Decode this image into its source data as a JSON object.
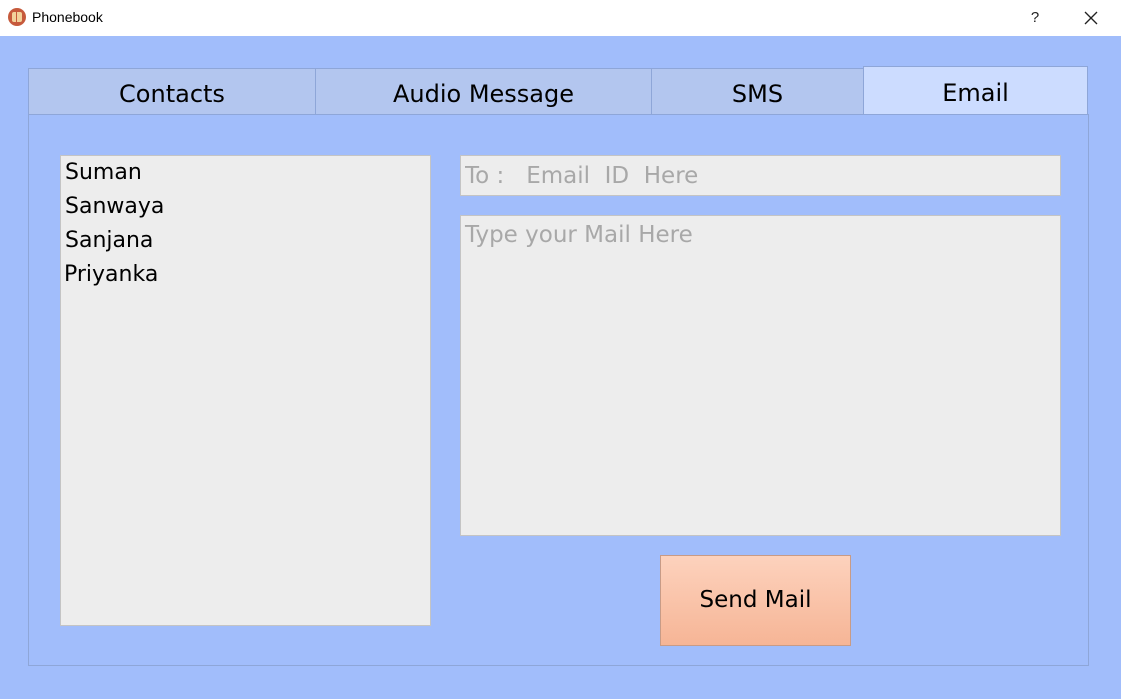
{
  "window": {
    "title": "Phonebook",
    "help_label": "?",
    "icon": "phonebook-icon",
    "close_icon": "close-icon"
  },
  "tabs": [
    {
      "label": "Contacts",
      "active": false
    },
    {
      "label": "Audio Message",
      "active": false
    },
    {
      "label": "SMS",
      "active": false
    },
    {
      "label": "Email",
      "active": true
    }
  ],
  "contacts": [
    "Suman",
    "Sanwaya",
    "Sanjana",
    "Priyanka"
  ],
  "email": {
    "to_placeholder": "To :   Email  ID  Here",
    "to_value": "",
    "body_placeholder": "Type your Mail Here",
    "body_value": "",
    "send_label": "Send Mail"
  },
  "colors": {
    "background": "#a1bdfb",
    "tab": "#b3c6ef",
    "tab_active": "#ccdcff",
    "field": "#ededed",
    "button": "#f9c2a7"
  }
}
